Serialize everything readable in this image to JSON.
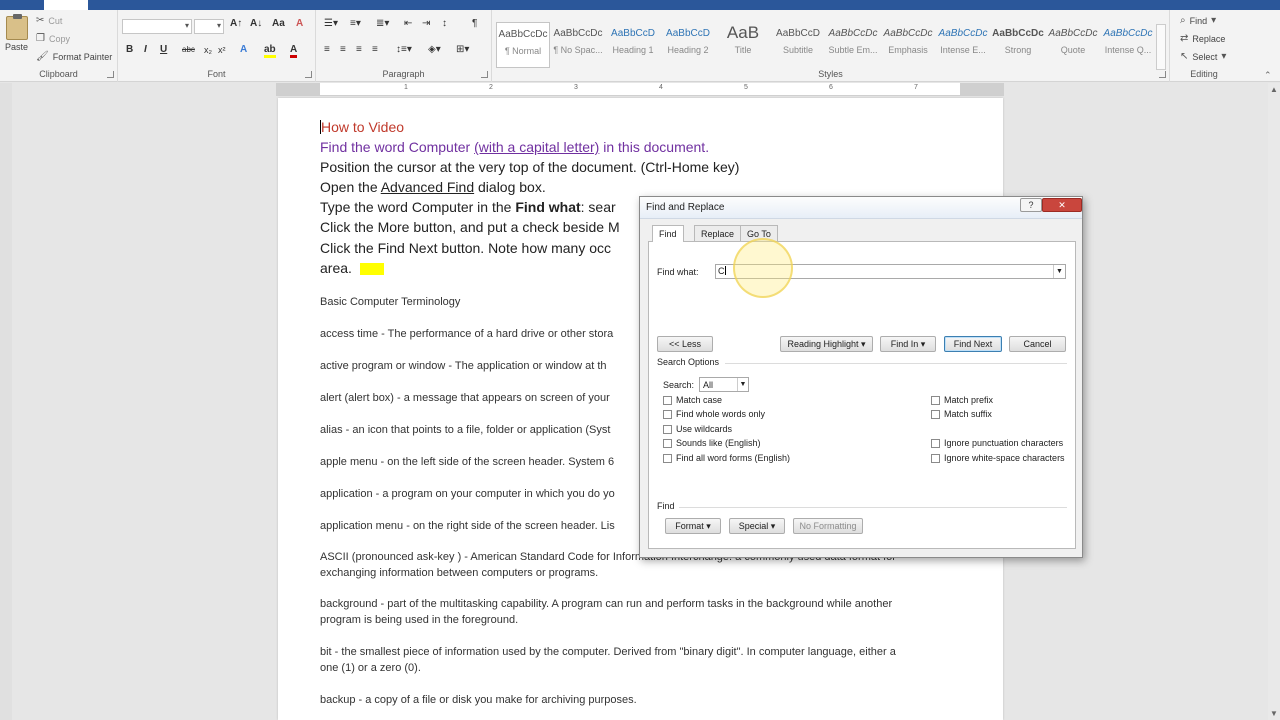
{
  "ribbon": {
    "clipboard": {
      "paste": "Paste",
      "cut": "Cut",
      "copy": "Copy",
      "format_painter": "Format Painter",
      "label": "Clipboard"
    },
    "font": {
      "label": "Font"
    },
    "paragraph": {
      "label": "Paragraph"
    },
    "styles": {
      "label": "Styles",
      "items": [
        {
          "sample": "AaBbCcDc",
          "name": "¶ Normal"
        },
        {
          "sample": "AaBbCcDc",
          "name": "¶ No Spac..."
        },
        {
          "sample": "AaBbCcD",
          "name": "Heading 1"
        },
        {
          "sample": "AaBbCcD",
          "name": "Heading 2"
        },
        {
          "sample": "AaB",
          "name": "Title"
        },
        {
          "sample": "AaBbCcD",
          "name": "Subtitle"
        },
        {
          "sample": "AaBbCcDc",
          "name": "Subtle Em..."
        },
        {
          "sample": "AaBbCcDc",
          "name": "Emphasis"
        },
        {
          "sample": "AaBbCcDc",
          "name": "Intense E..."
        },
        {
          "sample": "AaBbCcDc",
          "name": "Strong"
        },
        {
          "sample": "AaBbCcDc",
          "name": "Quote"
        },
        {
          "sample": "AaBbCcDc",
          "name": "Intense Q..."
        }
      ]
    },
    "editing": {
      "find": "Find",
      "replace": "Replace",
      "select": "Select",
      "label": "Editing"
    }
  },
  "ruler": {
    "numbers": [
      "1",
      "2",
      "3",
      "4",
      "5",
      "6",
      "7"
    ]
  },
  "document": {
    "lines": [
      {
        "text": "How to Video"
      },
      {
        "pre": "Find the word Computer ",
        "link": "(with a capital letter)",
        "post": " in this document."
      },
      {
        "text": "Position the cursor at the very top of the document. (Ctrl-Home key)"
      },
      {
        "pre": "Open the ",
        "link": "Advanced Find",
        "post": " dialog box."
      },
      {
        "pre": "Type the word Computer in the ",
        "bold": "Find what",
        "post": ": sear"
      },
      {
        "text": "Click the More button, and put a check beside M"
      },
      {
        "text": "Click the Find Next button. Note how many occ"
      },
      {
        "text": "area."
      }
    ],
    "body": [
      "Basic Computer Terminology",
      "access time - The performance of a hard drive or other stora",
      "active program or window - The application or window at th",
      "alert (alert box) - a message that appears on screen of your",
      "alias - an icon that points to a file, folder or application (Syst",
      "apple menu - on the left side of the screen header. System 6",
      "application - a program on your computer in which you do yo",
      "application menu - on the right side of the screen header. Lis",
      "ASCII (pronounced ask-key ) - American Standard Code for Information Interchange. a commonly used data format for",
      "exchanging information between computers or programs.",
      "background - part of the multitasking capability. A program can run and perform tasks in the background while another",
      "program is being used in the foreground.",
      "bit - the smallest piece of information used by the computer. Derived from \"binary digit\". In computer language, either a",
      "one (1) or a zero (0).",
      "backup - a copy of a file or disk you make for archiving purposes."
    ]
  },
  "dialog": {
    "title": "Find and Replace",
    "help": "?",
    "close": "✕",
    "tabs": [
      "Find",
      "Replace",
      "Go To"
    ],
    "find_what_label": "Find what:",
    "find_what_value": "C",
    "buttons": {
      "less": "<< Less",
      "reading_highlight": "Reading Highlight ▾",
      "find_in": "Find In ▾",
      "find_next": "Find Next",
      "cancel": "Cancel"
    },
    "search_options_label": "Search Options",
    "search_label": "Search:",
    "search_value": "All",
    "options_left": [
      "Match case",
      "Find whole words only",
      "Use wildcards",
      "Sounds like (English)",
      "Find all word forms (English)"
    ],
    "options_right": [
      "Match prefix",
      "Match suffix",
      "Ignore punctuation characters",
      "Ignore white-space characters"
    ],
    "find_section_label": "Find",
    "bottom_buttons": {
      "format": "Format ▾",
      "special": "Special ▾",
      "no_formatting": "No Formatting"
    }
  }
}
